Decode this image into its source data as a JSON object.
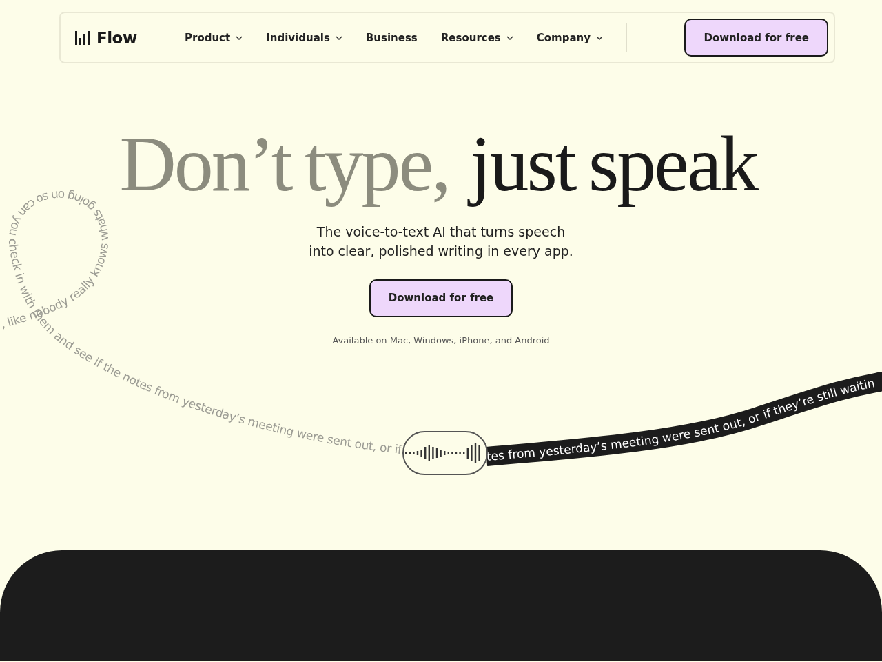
{
  "nav": {
    "logo": "Flow",
    "items": [
      {
        "label": "Product",
        "has_dropdown": true
      },
      {
        "label": "Individuals",
        "has_dropdown": true
      },
      {
        "label": "Business",
        "has_dropdown": false
      },
      {
        "label": "Resources",
        "has_dropdown": true
      },
      {
        "label": "Company",
        "has_dropdown": true
      }
    ],
    "cta": "Download for free"
  },
  "hero": {
    "headline_muted": "Don’t type,",
    "headline_strong": "just speak",
    "subtitle_lines": [
      "The voice-to-text AI that turns speech",
      "into clear, polished writing in every app."
    ],
    "cta": "Download for free",
    "availability": "Available on Mac, Windows, iPhone, and Android"
  },
  "voice_demo": {
    "spoken_text": ", like nobody really knows whats going on so can you check in with them and see if the notes from yesterday’s meeting were sent out, or if",
    "transcribed_text": "tes from yesterday’s meeting were sent out, or if they’re still waitin"
  }
}
